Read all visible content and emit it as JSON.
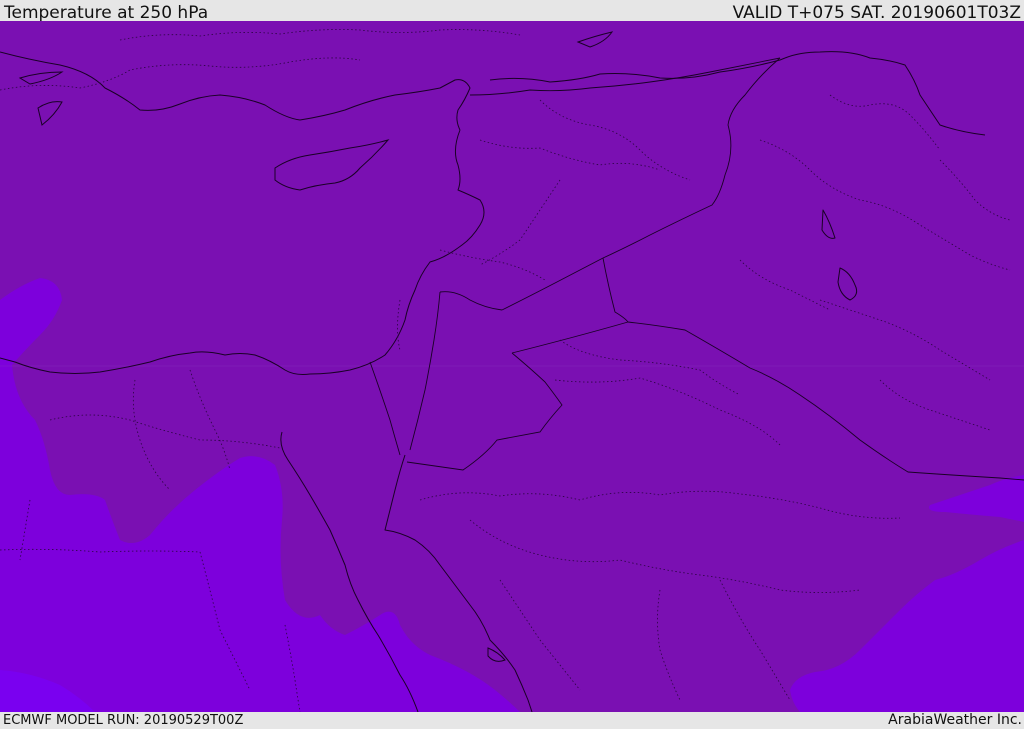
{
  "header": {
    "title": "Temperature at 250 hPa",
    "valid": "VALID T+075 SAT. 20190601T03Z"
  },
  "footer": {
    "model_run": "ECMWF MODEL RUN: 20190529T00Z",
    "credit": "ArabiaWeather Inc."
  },
  "map": {
    "field": "temperature",
    "level_hpa": 250,
    "colors": {
      "main_band": "#7a10b2",
      "cooler_band": "#7d00dc",
      "coldest_band": "#7a00f0",
      "boundaries": "#1a0026"
    }
  }
}
